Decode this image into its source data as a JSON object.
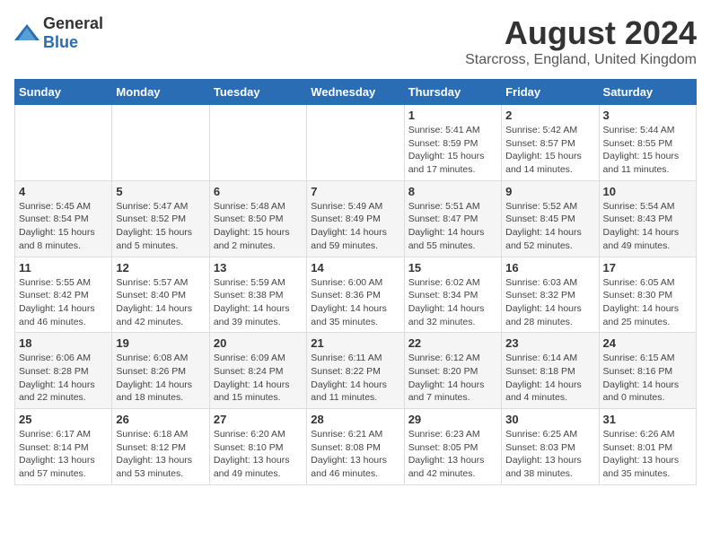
{
  "header": {
    "logo_general": "General",
    "logo_blue": "Blue",
    "title": "August 2024",
    "subtitle": "Starcross, England, United Kingdom"
  },
  "calendar": {
    "days_of_week": [
      "Sunday",
      "Monday",
      "Tuesday",
      "Wednesday",
      "Thursday",
      "Friday",
      "Saturday"
    ],
    "weeks": [
      [
        {
          "day": "",
          "info": ""
        },
        {
          "day": "",
          "info": ""
        },
        {
          "day": "",
          "info": ""
        },
        {
          "day": "",
          "info": ""
        },
        {
          "day": "1",
          "info": "Sunrise: 5:41 AM\nSunset: 8:59 PM\nDaylight: 15 hours and 17 minutes."
        },
        {
          "day": "2",
          "info": "Sunrise: 5:42 AM\nSunset: 8:57 PM\nDaylight: 15 hours and 14 minutes."
        },
        {
          "day": "3",
          "info": "Sunrise: 5:44 AM\nSunset: 8:55 PM\nDaylight: 15 hours and 11 minutes."
        }
      ],
      [
        {
          "day": "4",
          "info": "Sunrise: 5:45 AM\nSunset: 8:54 PM\nDaylight: 15 hours and 8 minutes."
        },
        {
          "day": "5",
          "info": "Sunrise: 5:47 AM\nSunset: 8:52 PM\nDaylight: 15 hours and 5 minutes."
        },
        {
          "day": "6",
          "info": "Sunrise: 5:48 AM\nSunset: 8:50 PM\nDaylight: 15 hours and 2 minutes."
        },
        {
          "day": "7",
          "info": "Sunrise: 5:49 AM\nSunset: 8:49 PM\nDaylight: 14 hours and 59 minutes."
        },
        {
          "day": "8",
          "info": "Sunrise: 5:51 AM\nSunset: 8:47 PM\nDaylight: 14 hours and 55 minutes."
        },
        {
          "day": "9",
          "info": "Sunrise: 5:52 AM\nSunset: 8:45 PM\nDaylight: 14 hours and 52 minutes."
        },
        {
          "day": "10",
          "info": "Sunrise: 5:54 AM\nSunset: 8:43 PM\nDaylight: 14 hours and 49 minutes."
        }
      ],
      [
        {
          "day": "11",
          "info": "Sunrise: 5:55 AM\nSunset: 8:42 PM\nDaylight: 14 hours and 46 minutes."
        },
        {
          "day": "12",
          "info": "Sunrise: 5:57 AM\nSunset: 8:40 PM\nDaylight: 14 hours and 42 minutes."
        },
        {
          "day": "13",
          "info": "Sunrise: 5:59 AM\nSunset: 8:38 PM\nDaylight: 14 hours and 39 minutes."
        },
        {
          "day": "14",
          "info": "Sunrise: 6:00 AM\nSunset: 8:36 PM\nDaylight: 14 hours and 35 minutes."
        },
        {
          "day": "15",
          "info": "Sunrise: 6:02 AM\nSunset: 8:34 PM\nDaylight: 14 hours and 32 minutes."
        },
        {
          "day": "16",
          "info": "Sunrise: 6:03 AM\nSunset: 8:32 PM\nDaylight: 14 hours and 28 minutes."
        },
        {
          "day": "17",
          "info": "Sunrise: 6:05 AM\nSunset: 8:30 PM\nDaylight: 14 hours and 25 minutes."
        }
      ],
      [
        {
          "day": "18",
          "info": "Sunrise: 6:06 AM\nSunset: 8:28 PM\nDaylight: 14 hours and 22 minutes."
        },
        {
          "day": "19",
          "info": "Sunrise: 6:08 AM\nSunset: 8:26 PM\nDaylight: 14 hours and 18 minutes."
        },
        {
          "day": "20",
          "info": "Sunrise: 6:09 AM\nSunset: 8:24 PM\nDaylight: 14 hours and 15 minutes."
        },
        {
          "day": "21",
          "info": "Sunrise: 6:11 AM\nSunset: 8:22 PM\nDaylight: 14 hours and 11 minutes."
        },
        {
          "day": "22",
          "info": "Sunrise: 6:12 AM\nSunset: 8:20 PM\nDaylight: 14 hours and 7 minutes."
        },
        {
          "day": "23",
          "info": "Sunrise: 6:14 AM\nSunset: 8:18 PM\nDaylight: 14 hours and 4 minutes."
        },
        {
          "day": "24",
          "info": "Sunrise: 6:15 AM\nSunset: 8:16 PM\nDaylight: 14 hours and 0 minutes."
        }
      ],
      [
        {
          "day": "25",
          "info": "Sunrise: 6:17 AM\nSunset: 8:14 PM\nDaylight: 13 hours and 57 minutes."
        },
        {
          "day": "26",
          "info": "Sunrise: 6:18 AM\nSunset: 8:12 PM\nDaylight: 13 hours and 53 minutes."
        },
        {
          "day": "27",
          "info": "Sunrise: 6:20 AM\nSunset: 8:10 PM\nDaylight: 13 hours and 49 minutes."
        },
        {
          "day": "28",
          "info": "Sunrise: 6:21 AM\nSunset: 8:08 PM\nDaylight: 13 hours and 46 minutes."
        },
        {
          "day": "29",
          "info": "Sunrise: 6:23 AM\nSunset: 8:05 PM\nDaylight: 13 hours and 42 minutes."
        },
        {
          "day": "30",
          "info": "Sunrise: 6:25 AM\nSunset: 8:03 PM\nDaylight: 13 hours and 38 minutes."
        },
        {
          "day": "31",
          "info": "Sunrise: 6:26 AM\nSunset: 8:01 PM\nDaylight: 13 hours and 35 minutes."
        }
      ]
    ]
  }
}
